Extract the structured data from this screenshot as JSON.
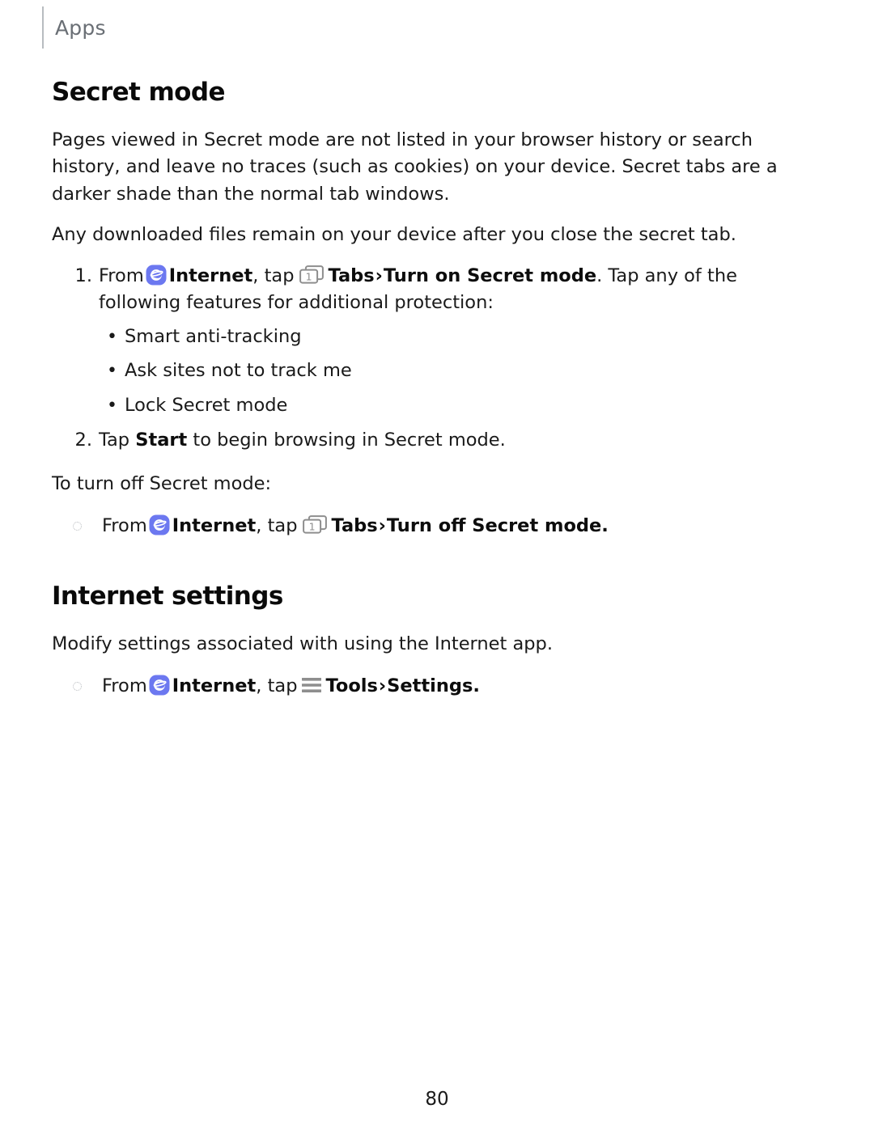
{
  "page": {
    "running_header": "Apps",
    "page_number": "80"
  },
  "colors": {
    "internet_icon_bg": "#6C78F0",
    "internet_icon_glyph": "#FFFFFF",
    "tabs_icon_stroke": "#8E8E8E",
    "tools_icon_bars": "#8E8E8E",
    "header_rule": "#B8BCC0",
    "header_text": "#6A6F75",
    "body_text": "#1A1A1A",
    "heading_text": "#0A0A0A",
    "circle_bullet": "#B9BCC0"
  },
  "icons": {
    "internet": "internet-app-icon",
    "tabs": "tabs-icon",
    "tools": "tools-icon",
    "chevron": "›"
  },
  "sections": [
    {
      "heading": "Secret mode",
      "paragraphs": [
        "Pages viewed in Secret mode are not listed in your browser history or search history, and leave no traces (such as cookies) on your device. Secret tabs are a darker shade than the normal tab windows.",
        "Any downloaded files remain on your device after you close the secret tab."
      ]
    },
    {
      "heading": "Internet settings",
      "paragraphs": [
        "Modify settings associated with using the Internet app."
      ]
    }
  ],
  "steps": {
    "step1": {
      "number": "1.",
      "text_from": "From",
      "text_internet": "Internet",
      "text_tap": ", tap",
      "label_tabs": "Tabs",
      "chevron": "›",
      "label_action": "Turn on Secret mode",
      "text_tail": ". Tap any of the following features for additional protection:",
      "bullets": [
        "Smart anti-tracking",
        "Ask sites not to track me",
        "Lock Secret mode"
      ]
    },
    "step2": {
      "number": "2.",
      "text_lead": "Tap",
      "label_start": "Start",
      "text_tail": "to begin browsing in Secret mode."
    }
  },
  "turn_off": {
    "intro": "To turn off Secret mode:",
    "item": {
      "text_from": "From",
      "text_internet": "Internet",
      "text_tap": ", tap",
      "label_tabs": "Tabs",
      "chevron": "›",
      "label_action": "Turn off Secret mode",
      "text_tail": "."
    }
  },
  "internet_settings": {
    "item": {
      "text_from": "From",
      "text_internet": "Internet",
      "text_tap": ", tap",
      "label_tools": "Tools",
      "chevron": "›",
      "label_settings": "Settings",
      "text_tail": "."
    }
  }
}
